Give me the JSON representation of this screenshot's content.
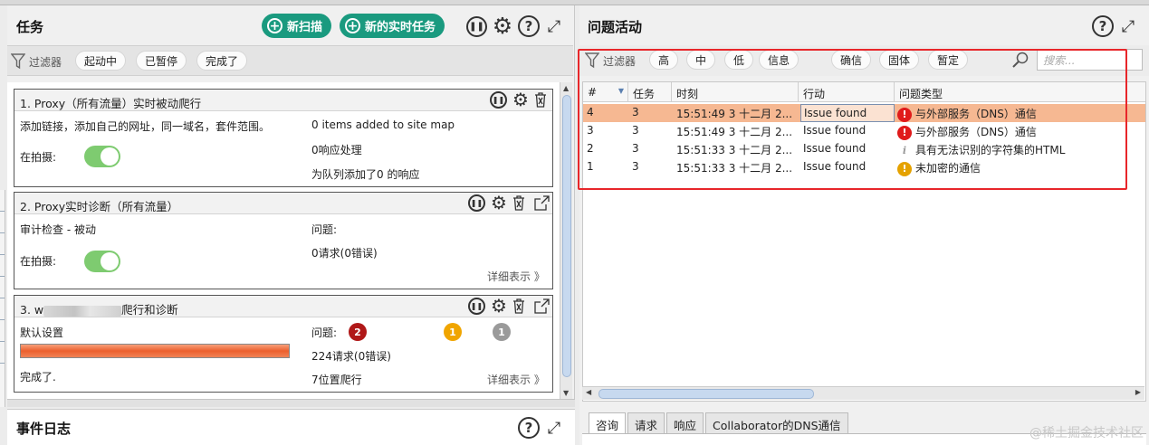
{
  "tasks_panel": {
    "title": "任务",
    "new_scan_label": "新扫描",
    "new_live_task_label": "新的实时任务",
    "filter_label": "过滤器",
    "filters": [
      "起动中",
      "已暂停",
      "完成了"
    ]
  },
  "tasks": [
    {
      "name": "1. Proxy（所有流量）实时被动爬行",
      "description": "添加链接，添加自己的网址，同一域名，套件范围。",
      "capture_label": "在拍摄:",
      "capturing": true,
      "stats": [
        "0 items added to site map",
        "0响应处理",
        "为队列添加了0 的响应"
      ]
    },
    {
      "name": "2. Proxy实时诊断（所有流量）",
      "description": "审计检查 - 被动",
      "capture_label": "在拍摄:",
      "capturing": true,
      "issues_label": "问题:",
      "requests": "0请求(0错误)",
      "more_label": "详细表示 》"
    },
    {
      "name_prefix": "3. w",
      "name_suffix": "爬行和诊断",
      "description": "默认设置",
      "status": "完成了.",
      "progress": 1.0,
      "issues_label": "问题:",
      "issue_counts": {
        "high": "2",
        "medium": "1",
        "low": "1"
      },
      "requests": "224请求(0错误)",
      "locations": "7位置爬行",
      "more_label": "详细表示 》"
    }
  ],
  "event_log": {
    "title": "事件日志"
  },
  "issue_activity": {
    "title": "问题活动",
    "filter_label": "过滤器",
    "severity_filters": [
      "高",
      "中",
      "低",
      "信息"
    ],
    "confidence_filters": [
      "确信",
      "固体",
      "暂定"
    ],
    "search_placeholder": "搜索...",
    "columns": [
      "#",
      "任务",
      "时刻",
      "行动",
      "问题类型"
    ],
    "rows": [
      {
        "num": "4",
        "task": "3",
        "time": "15:51:49 3 十二月 2...",
        "action": "Issue found",
        "severity": "high",
        "issue_type": "与外部服务（DNS）通信",
        "selected": true
      },
      {
        "num": "3",
        "task": "3",
        "time": "15:51:49 3 十二月 2...",
        "action": "Issue found",
        "severity": "high",
        "issue_type": "与外部服务（DNS）通信",
        "selected": false
      },
      {
        "num": "2",
        "task": "3",
        "time": "15:51:33 3 十二月 2...",
        "action": "Issue found",
        "severity": "info",
        "issue_type": "具有无法识别的字符集的HTML",
        "selected": false
      },
      {
        "num": "1",
        "task": "3",
        "time": "15:51:33 3 十二月 2...",
        "action": "Issue found",
        "severity": "medium",
        "issue_type": "未加密的通信",
        "selected": false
      }
    ],
    "detail_tabs": [
      "咨询",
      "请求",
      "响应",
      "Collaborator的DNS通信"
    ],
    "active_tab": 0
  },
  "watermark": "@稀土掘金技术社区",
  "colors": {
    "accent_green": "#1a9a7f",
    "selected_row": "#f6b892",
    "highlight_box": "#e8262a",
    "severity_high": "#e01b1b",
    "severity_medium": "#e5a200"
  }
}
